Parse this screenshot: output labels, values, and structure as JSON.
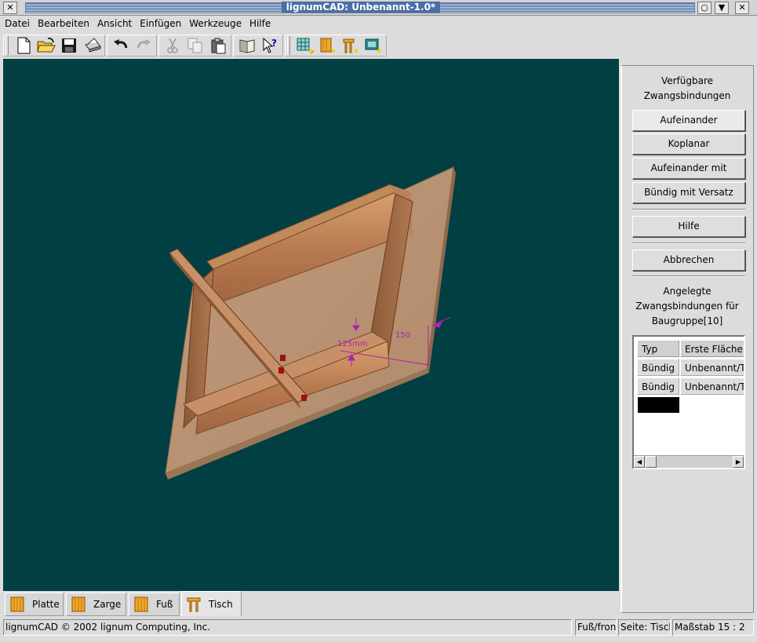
{
  "window": {
    "title": "lignumCAD: Unbenannt-1.0*",
    "close_glyph": "✕",
    "min_glyph": "○",
    "max_glyph": "▼",
    "x_glyph": "✕"
  },
  "menu": [
    "Datei",
    "Bearbeiten",
    "Ansicht",
    "Einfügen",
    "Werkzeuge",
    "Hilfe"
  ],
  "toolbar": {
    "icons": [
      "new-file-icon",
      "open-folder-icon",
      "save-icon",
      "print-icon",
      "undo-icon",
      "redo-icon",
      "cut-icon",
      "copy-icon",
      "paste-icon",
      "book-icon",
      "whats-this-icon",
      "new-page-icon",
      "new-part-icon",
      "new-assembly-icon",
      "new-drawing-icon"
    ]
  },
  "viewport": {
    "background": "#023f43",
    "dimension_labels": [
      "125mm",
      "150"
    ],
    "dimension_color": "#b020b0"
  },
  "side": {
    "available_heading_1": "Verfügbare",
    "available_heading_2": "Zwangsbindungen",
    "buttons": {
      "mate": "Aufeinander",
      "coplanar": "Koplanar",
      "mate_offset": "Aufeinander mit Abstand",
      "flush_offset": "Bündig mit Versatz",
      "help": "Hilfe",
      "cancel": "Abbrechen"
    },
    "applied_heading_1": "Angelegte",
    "applied_heading_2": "Zwangsbindungen für",
    "applied_heading_3": "Baugruppe[10]",
    "table": {
      "columns": [
        "Typ",
        "Erste Fläche"
      ],
      "rows": [
        [
          "Bündig",
          "Unbenannt/Ti"
        ],
        [
          "Bündig",
          "Unbenannt/Ti"
        ]
      ]
    }
  },
  "tabs": [
    {
      "label": "Platte",
      "icon": "board-icon"
    },
    {
      "label": "Zarge",
      "icon": "board-icon"
    },
    {
      "label": "Fuß",
      "icon": "board-icon"
    },
    {
      "label": "Tisch",
      "icon": "table-icon"
    }
  ],
  "status": {
    "message": "lignumCAD © 2002 lignum Computing, Inc.",
    "view": "Fuß/front",
    "page": "Seite: Tisch",
    "scale": "Maßstab 15 : 2"
  }
}
